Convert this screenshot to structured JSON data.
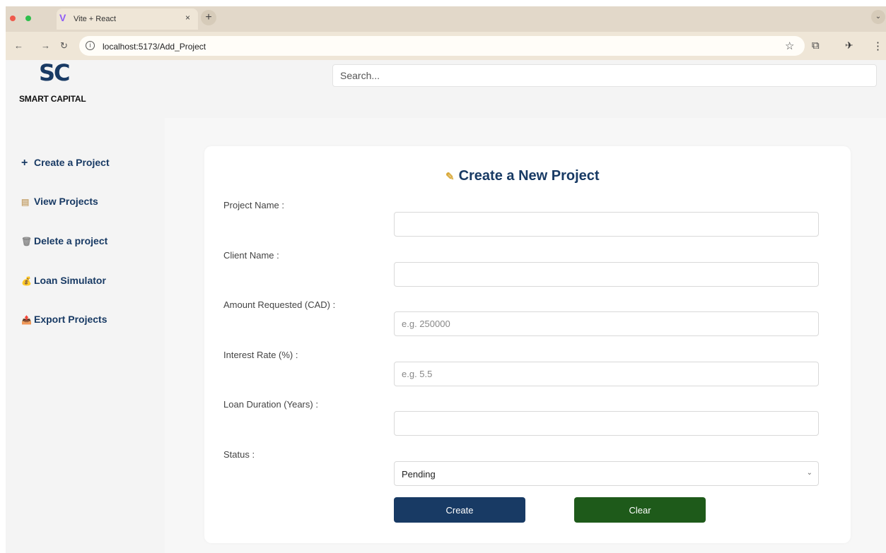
{
  "browser": {
    "tab_title": "Vite + React",
    "tab_close": "×",
    "new_tab": "+",
    "url": "localhost:5173/Add_Project"
  },
  "brand": {
    "logo_mark": "SC",
    "logo_text": "SMART CAPITAL"
  },
  "header": {
    "search_placeholder": "Search..."
  },
  "sidebar": {
    "items": [
      {
        "icon": "plus-icon",
        "glyph": "+",
        "label": "Create a Project"
      },
      {
        "icon": "list-icon",
        "glyph": "▤",
        "label": "View Projects"
      },
      {
        "icon": "trash-icon",
        "glyph": "🗑",
        "label": "Delete a project"
      },
      {
        "icon": "money-bag-icon",
        "glyph": "💰",
        "label": "Loan Simulator"
      },
      {
        "icon": "export-icon",
        "glyph": "📤",
        "label": "Export Projects"
      }
    ]
  },
  "form": {
    "title": "Create a New Project",
    "title_icon": "memo-icon",
    "fields": [
      {
        "label": "Project Name :",
        "value": "",
        "placeholder": ""
      },
      {
        "label": "Client Name :",
        "value": "",
        "placeholder": ""
      },
      {
        "label": "Amount Requested (CAD) :",
        "value": "",
        "placeholder": "e.g. 250000"
      },
      {
        "label": "Interest Rate (%) :",
        "value": "",
        "placeholder": "e.g. 5.5"
      },
      {
        "label": "Loan Duration (Years) :",
        "value": "",
        "placeholder": ""
      }
    ],
    "status": {
      "label": "Status :",
      "selected": "Pending"
    },
    "buttons": {
      "create": "Create",
      "clear": "Clear"
    }
  },
  "colors": {
    "brand": "#183a64",
    "clear_button": "#1e5a1a",
    "tabbar": "#e2d8c9"
  }
}
